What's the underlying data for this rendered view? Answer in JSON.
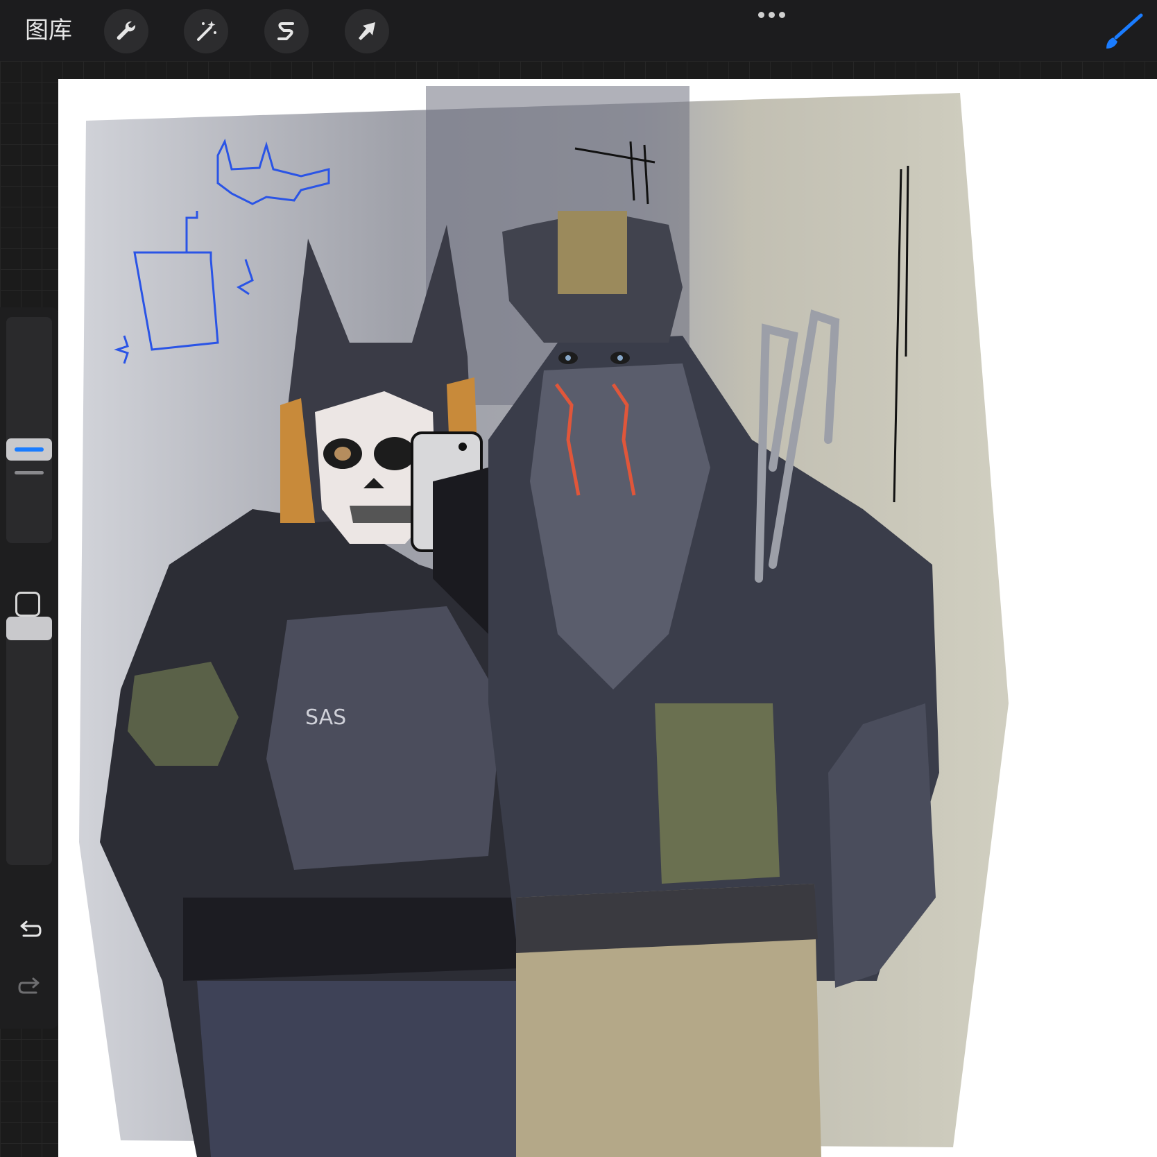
{
  "topbar": {
    "gallery_label": "图库",
    "tools": [
      {
        "name": "actions",
        "icon": "wrench-icon"
      },
      {
        "name": "adjustments",
        "icon": "magic-wand-icon"
      },
      {
        "name": "selection",
        "icon": "selection-s-icon"
      },
      {
        "name": "transform",
        "icon": "arrow-cursor-icon"
      }
    ],
    "more_icon": "ellipsis-icon",
    "brush_icon": "paintbrush-icon",
    "accent_color": "#1a7cff"
  },
  "sidebar": {
    "size_slider_level": 0.54,
    "opacity_slider_level": 0.0,
    "modify_icon": "square-outline-icon",
    "undo_icon": "undo-arrow-icon",
    "redo_icon": "redo-arrow-icon"
  },
  "artwork": {
    "description_icon": "illustration",
    "text_on_vest": "SAS"
  }
}
